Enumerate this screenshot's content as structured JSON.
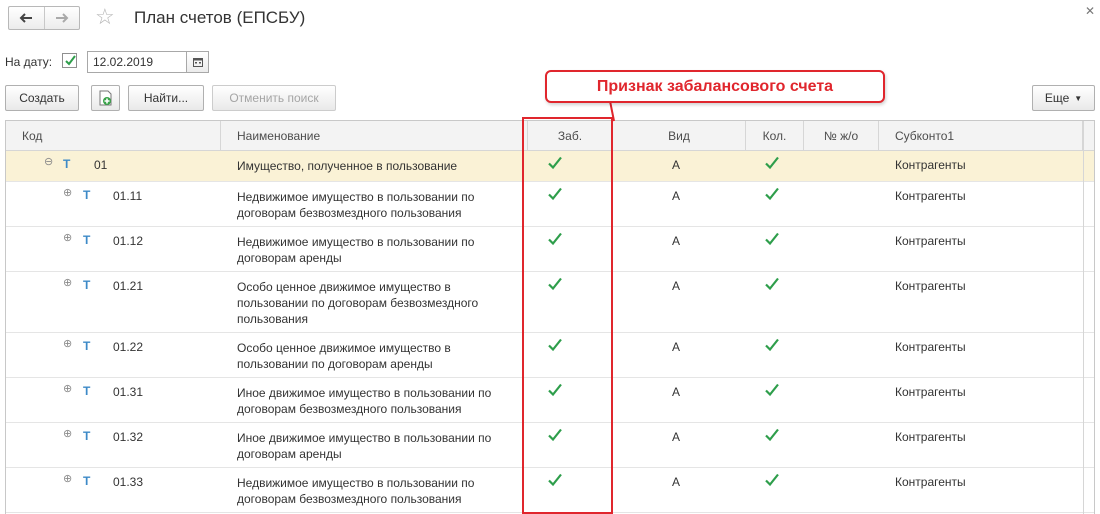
{
  "header": {
    "title": "План счетов (ЕПСБУ)",
    "back_icon": "arrow-left-icon",
    "forward_icon": "arrow-right-icon",
    "favorite_icon": "star-icon",
    "close_icon": "close-icon"
  },
  "filter": {
    "date_label": "На дату:",
    "date_checked": true,
    "date_value": "12.02.2019",
    "calendar_icon": "calendar-icon"
  },
  "toolbar": {
    "create_label": "Создать",
    "copy_icon": "add-copy-icon",
    "find_label": "Найти...",
    "cancel_search_label": "Отменить поиск",
    "more_label": "Еще"
  },
  "callout": {
    "text": "Признак забалансового счета",
    "border_color": "#e0262d"
  },
  "table": {
    "columns": [
      "Код",
      "Наименование",
      "Заб.",
      "Вид",
      "Кол.",
      "№ ж/о",
      "Субконто1"
    ],
    "rows": [
      {
        "code": "01",
        "name": "Имущество, полученное в пользование",
        "zab": true,
        "vid": "А",
        "kol": true,
        "journal": "",
        "subkonto": "Контрагенты"
      },
      {
        "code": "01.11",
        "name": "Недвижимое имущество в пользовании по договорам безвозмездного пользования",
        "zab": true,
        "vid": "А",
        "kol": true,
        "journal": "",
        "subkonto": "Контрагенты"
      },
      {
        "code": "01.12",
        "name": "Недвижимое имущество в пользовании по договорам аренды",
        "zab": true,
        "vid": "А",
        "kol": true,
        "journal": "",
        "subkonto": "Контрагенты"
      },
      {
        "code": "01.21",
        "name": "Особо ценное движимое имущество в пользовании по договорам безвозмездного пользования",
        "zab": true,
        "vid": "А",
        "kol": true,
        "journal": "",
        "subkonto": "Контрагенты"
      },
      {
        "code": "01.22",
        "name": "Особо ценное движимое имущество в пользовании по договорам аренды",
        "zab": true,
        "vid": "А",
        "kol": true,
        "journal": "",
        "subkonto": "Контрагенты"
      },
      {
        "code": "01.31",
        "name": "Иное движимое имущество в пользовании по договорам безвозмездного пользования",
        "zab": true,
        "vid": "А",
        "kol": true,
        "journal": "",
        "subkonto": "Контрагенты"
      },
      {
        "code": "01.32",
        "name": "Иное движимое имущество в пользовании по договорам аренды",
        "zab": true,
        "vid": "А",
        "kol": true,
        "journal": "",
        "subkonto": "Контрагенты"
      },
      {
        "code": "01.33",
        "name": "Недвижимое имущество в пользовании по договорам безвозмездного пользования",
        "zab": true,
        "vid": "А",
        "kol": true,
        "journal": "",
        "subkonto": "Контрагенты"
      }
    ],
    "type_marker": "Т",
    "colors": {
      "selected_row": "#faf2d6",
      "check": "#2e9e4b",
      "type_marker": "#3d8ac7",
      "highlight": "#e0262d"
    }
  }
}
